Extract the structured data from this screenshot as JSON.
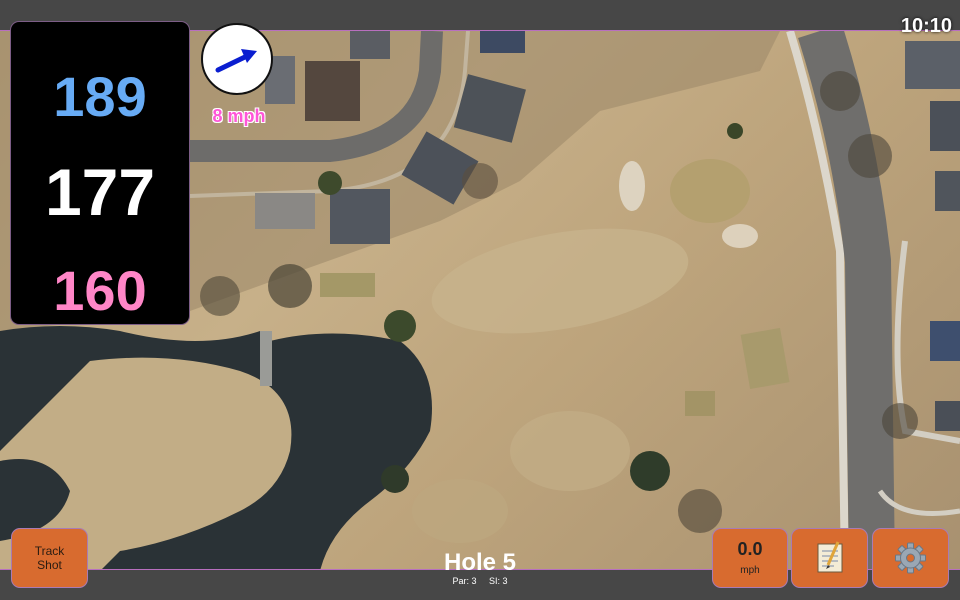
{
  "clock": "10:10",
  "distances": {
    "back": "189",
    "center": "177",
    "front": "160"
  },
  "wind": {
    "label": "8 mph",
    "icon": "wind-direction-arrow-icon"
  },
  "buttons": {
    "track_shot": "Track\nShot",
    "speed_value": "0.0",
    "speed_unit": "mph",
    "notes_icon": "notepad-icon",
    "settings_icon": "gear-icon"
  },
  "hole": {
    "title": "Hole 5",
    "par": "Par: 3",
    "si": "SI: 3"
  },
  "colors": {
    "back_distance": "#67abf5",
    "center_distance": "#ffffff",
    "front_distance": "#ff86c7",
    "wind_label": "#ff56d8",
    "button": "#d86b2f",
    "panel_border": "#b86fbf"
  }
}
